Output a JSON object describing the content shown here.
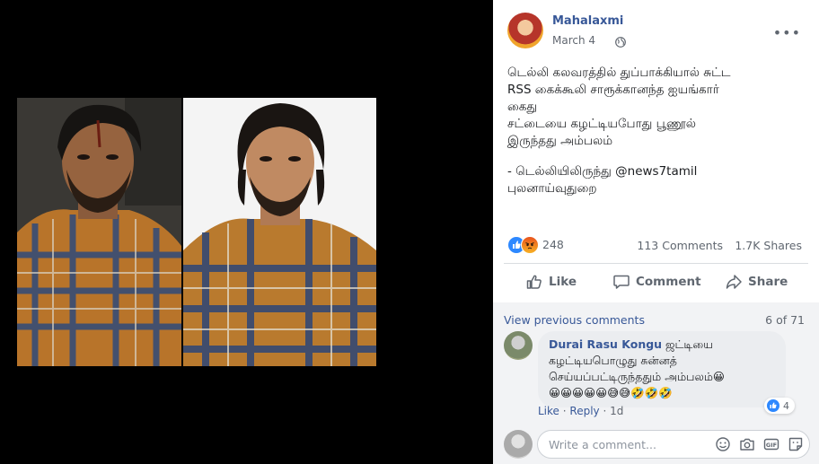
{
  "post": {
    "author": "Mahalaxmi",
    "date": "March 4",
    "text_lines": [
      "டெல்லி கலவரத்தில் துப்பாக்கியால் சுட்ட",
      "RSS கைக்கூலி சாரூக்கானந்த ஐயங்கார்",
      "கைது",
      "சட்டையை கழட்டியபோது பூணூல்",
      "இருந்தது அம்பலம்",
      "",
      "- டெல்லியிலிருந்து @news7tamil",
      "புலனாய்வுதுறை"
    ]
  },
  "stats": {
    "reactions": "248",
    "comments": "113 Comments",
    "shares": "1.7K Shares"
  },
  "actions": {
    "like": "Like",
    "comment": "Comment",
    "share": "Share"
  },
  "comments_section": {
    "view_previous": "View previous comments",
    "count": "6 of 71",
    "comment": {
      "name": "Durai Rasu Kongu",
      "text_line1": "ஜட்டியை",
      "text_line2": "கழட்டியபொழுது சுன்னத்",
      "text_line3": "செய்யப்பட்டிருந்ததும் அம்பலம்😀",
      "emojis": "😀😀😀😀😀😅😅🤣🤣🤣",
      "like_label": "Like",
      "reply_label": "Reply",
      "age": "1d",
      "reaction_count": "4"
    },
    "composer_placeholder": "Write a comment..."
  },
  "colors": {
    "link_blue": "#385898",
    "like_blue": "#2d88ff",
    "muted_text": "#606770"
  }
}
